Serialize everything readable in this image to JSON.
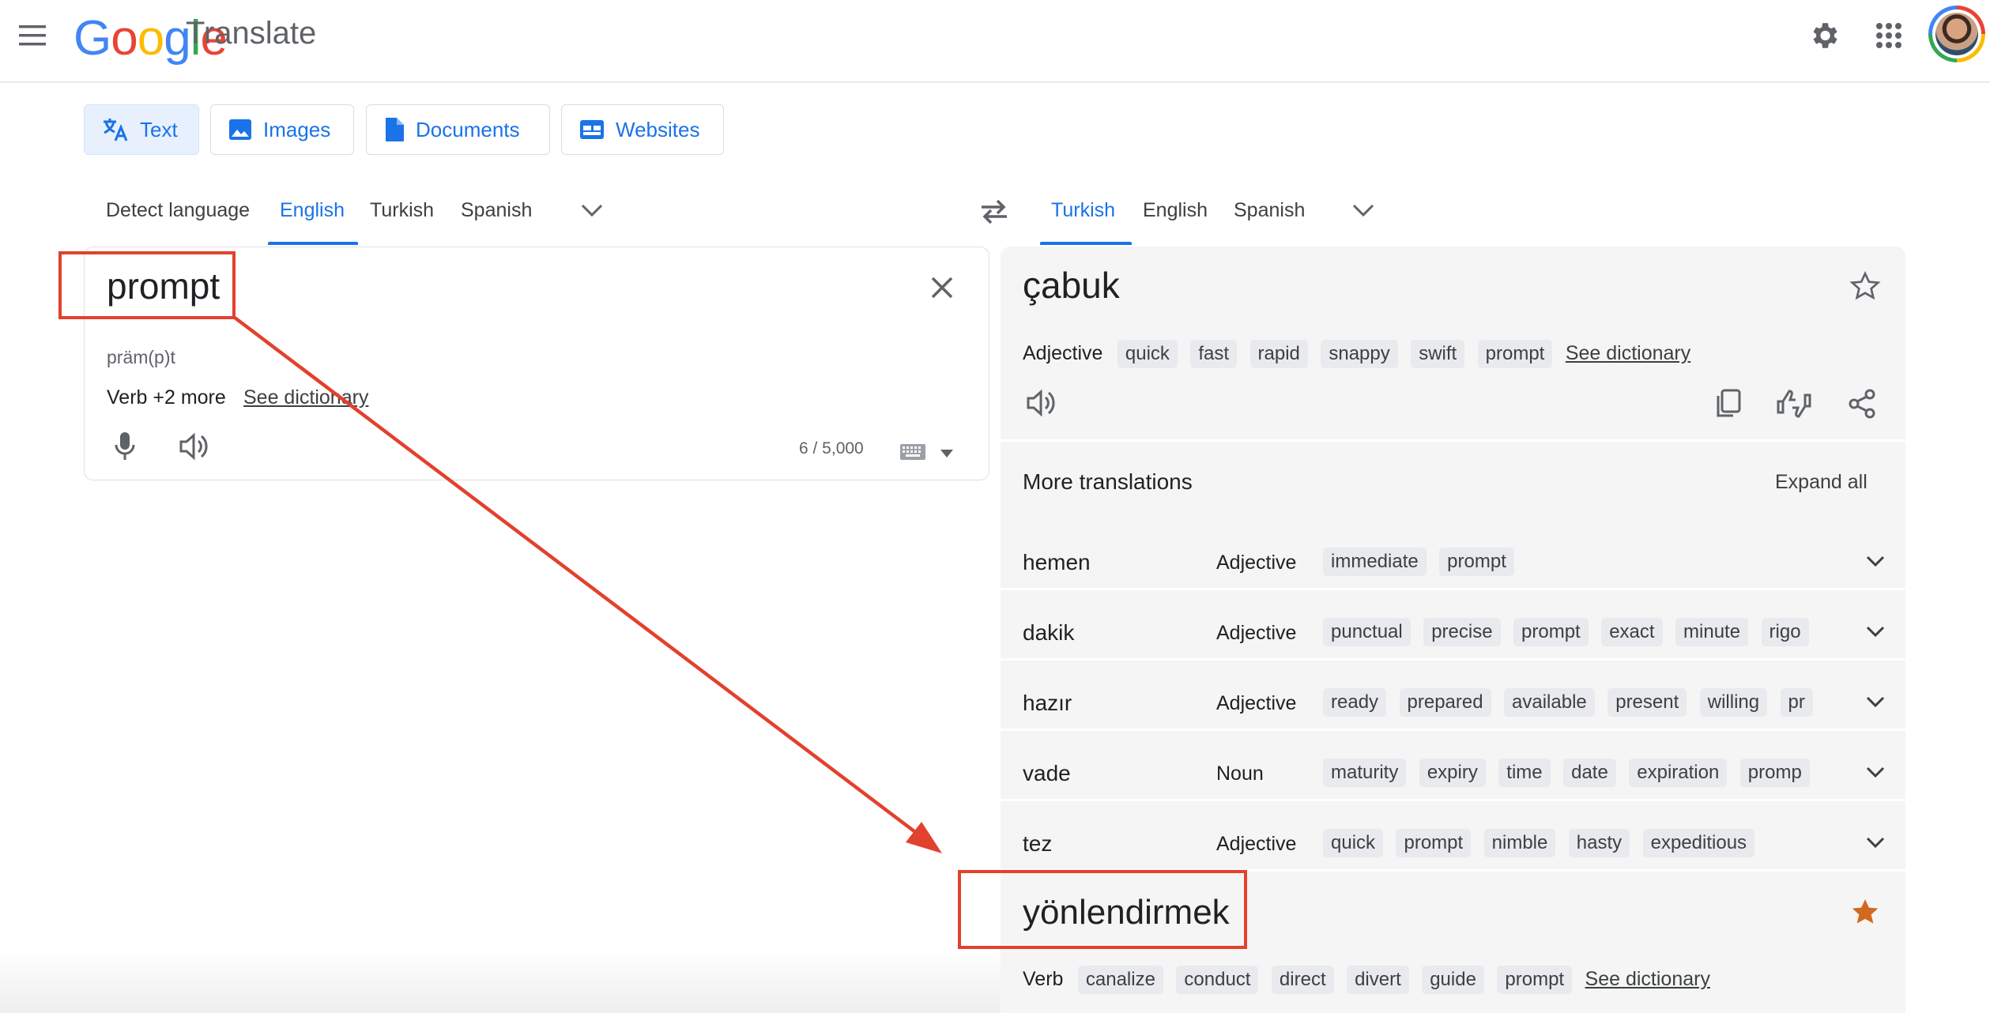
{
  "header": {
    "brand_logo": "Google",
    "app_name": "Translate",
    "brand_colors": [
      "#4285f4",
      "#ea4335",
      "#fbbc04",
      "#4285f4",
      "#34a853",
      "#ea4335"
    ]
  },
  "mode_tabs": [
    {
      "label": "Text",
      "icon": "translate-icon",
      "active": true
    },
    {
      "label": "Images",
      "icon": "image-icon",
      "active": false
    },
    {
      "label": "Documents",
      "icon": "document-icon",
      "active": false
    },
    {
      "label": "Websites",
      "icon": "website-icon",
      "active": false
    }
  ],
  "source_langs": [
    "Detect language",
    "English",
    "Turkish",
    "Spanish"
  ],
  "source_selected": "English",
  "target_langs": [
    "Turkish",
    "English",
    "Spanish"
  ],
  "target_selected": "Turkish",
  "source": {
    "text": "prompt",
    "phonetic": "präm(p)t",
    "pos_summary": "Verb +2 more",
    "see_dictionary": "See dictionary",
    "char_count": "6 / 5,000"
  },
  "target": {
    "text": "çabuk",
    "pos": "Adjective",
    "chips": [
      "quick",
      "fast",
      "rapid",
      "snappy",
      "swift",
      "prompt"
    ],
    "see_dictionary": "See dictionary"
  },
  "more_translations": {
    "title": "More translations",
    "expand_all": "Expand all",
    "rows": [
      {
        "word": "hemen",
        "pos": "Adjective",
        "chips": [
          "immediate",
          "prompt"
        ]
      },
      {
        "word": "dakik",
        "pos": "Adjective",
        "chips": [
          "punctual",
          "precise",
          "prompt",
          "exact",
          "minute",
          "rigo"
        ]
      },
      {
        "word": "hazır",
        "pos": "Adjective",
        "chips": [
          "ready",
          "prepared",
          "available",
          "present",
          "willing",
          "pr"
        ]
      },
      {
        "word": "vade",
        "pos": "Noun",
        "chips": [
          "maturity",
          "expiry",
          "time",
          "date",
          "expiration",
          "promp"
        ]
      },
      {
        "word": "tez",
        "pos": "Adjective",
        "chips": [
          "quick",
          "prompt",
          "nimble",
          "hasty",
          "expeditious"
        ]
      }
    ]
  },
  "second_translation": {
    "text": "yönlendirmek",
    "pos": "Verb",
    "chips": [
      "canalize",
      "conduct",
      "direct",
      "divert",
      "guide",
      "prompt"
    ],
    "see_dictionary": "See dictionary",
    "starred": true
  },
  "colors": {
    "accent": "#1a73e8",
    "annotation_red": "#e2412e",
    "star_filled": "#d2691e",
    "panel_bg": "#f5f5f5"
  }
}
